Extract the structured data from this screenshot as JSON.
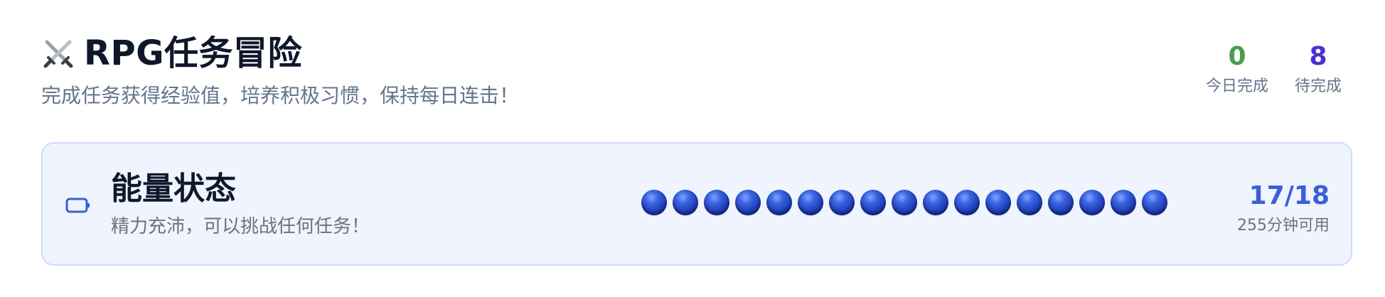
{
  "header": {
    "icon": "crossed-swords-icon",
    "title": "RPG任务冒险",
    "subtitle": "完成任务获得经验值，培养积极习惯，保持每日连击！"
  },
  "stats": {
    "completed_today": {
      "value": "0",
      "label": "今日完成",
      "color": "#4a9d4d"
    },
    "pending": {
      "value": "8",
      "label": "待完成",
      "color": "#4c2fd6"
    }
  },
  "energy": {
    "icon": "battery-icon",
    "title": "能量状态",
    "description": "精力充沛，可以挑战任何任务！",
    "current": 17,
    "max": 18,
    "count_text": "17/18",
    "time_text": "255分钟可用",
    "orb_color": "#1f3fb8",
    "accent_color": "#3b5fd6"
  }
}
